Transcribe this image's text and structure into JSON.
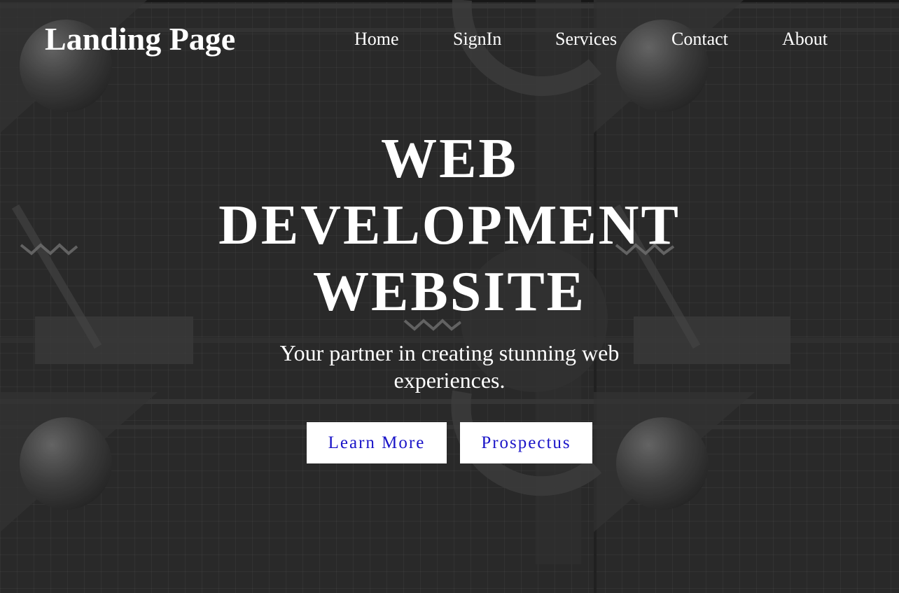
{
  "header": {
    "brand": "Landing Page",
    "nav": [
      "Home",
      "SignIn",
      "Services",
      "Contact",
      "About"
    ]
  },
  "hero": {
    "title_lines": [
      "WEB",
      "DEVELOPMENT",
      "WEBSITE"
    ],
    "subtitle": "Your partner in creating stunning web experiences.",
    "buttons": {
      "learn_more": "Learn More",
      "prospectus": "Prospectus"
    }
  },
  "colors": {
    "background": "#333333",
    "text": "#ffffff",
    "button_bg": "#ffffff",
    "button_text": "#1a14c8"
  }
}
